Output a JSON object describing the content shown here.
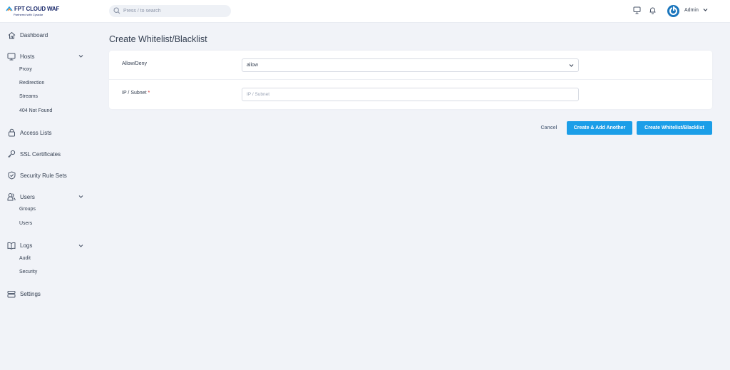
{
  "brand": {
    "name": "FPT CLOUD  WAF",
    "tagline": "Partnered with Cyradar"
  },
  "search": {
    "placeholder": "Press / to search"
  },
  "header": {
    "user_name": "Admin"
  },
  "sidebar": {
    "items": [
      {
        "label": "Dashboard",
        "icon": "home-icon"
      },
      {
        "label": "Hosts",
        "icon": "monitor-icon",
        "children": [
          "Proxy",
          "Redirection",
          "Streams",
          "404 Not Found"
        ]
      },
      {
        "label": "Access Lists",
        "icon": "lock-icon"
      },
      {
        "label": "SSL Certificates",
        "icon": "key-icon"
      },
      {
        "label": "Security Rule Sets",
        "icon": "shield-icon"
      },
      {
        "label": "Users",
        "icon": "users-icon",
        "children": [
          "Groups",
          "Users"
        ]
      },
      {
        "label": "Logs",
        "icon": "book-icon",
        "children": [
          "Audit",
          "Security"
        ]
      },
      {
        "label": "Settings",
        "icon": "settings-icon"
      }
    ]
  },
  "main": {
    "title": "Create Whitelist/Blacklist",
    "form": {
      "action_label": "Allow/Deny",
      "action_value": "allow",
      "ip_label": "IP / Subnet",
      "ip_required_mark": "*",
      "ip_placeholder": "IP / Subnet"
    },
    "buttons": {
      "cancel": "Cancel",
      "create_add_another": "Create & Add Another",
      "create": "Create Whitelist/Blacklist"
    }
  },
  "colors": {
    "primary": "#1b9ee8",
    "brand": "#1b76bd",
    "required": "#cd201f",
    "background": "#f1f3f8"
  }
}
